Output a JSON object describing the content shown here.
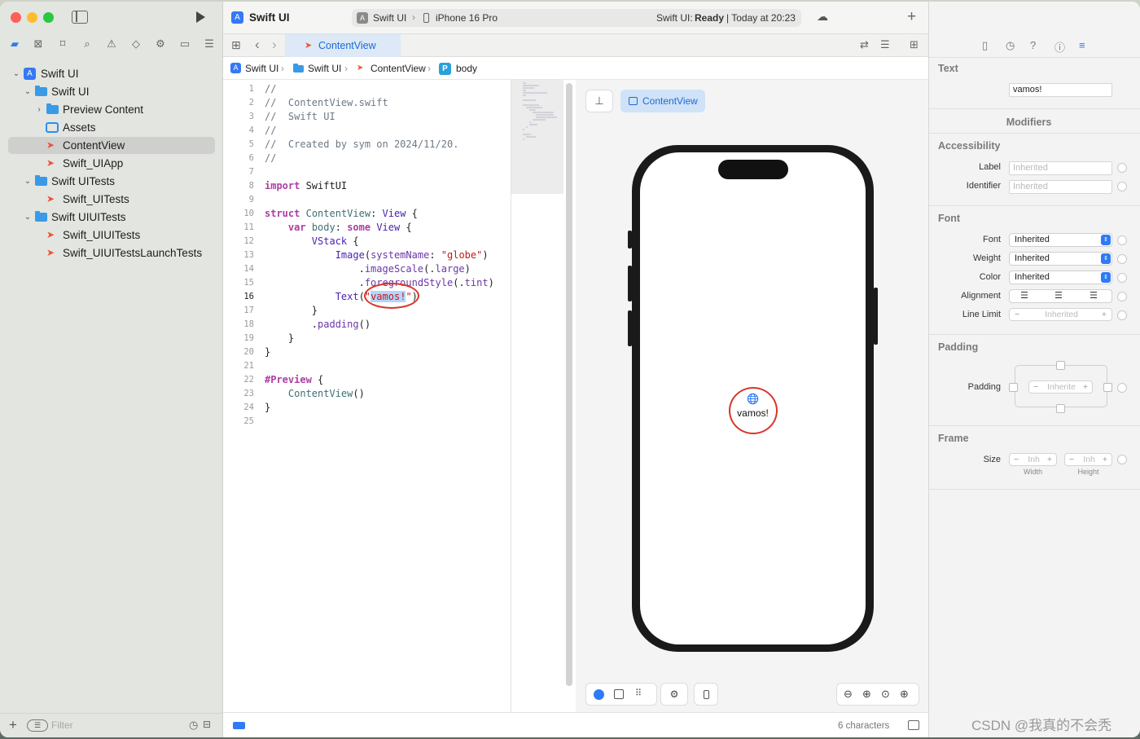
{
  "project": {
    "name": "Swift UI"
  },
  "toolbar": {
    "scheme_name": "Swift UI",
    "destination": "iPhone 16 Pro",
    "status_project": "Swift UI:",
    "status_state": "Ready",
    "status_time": "| Today at 20:23",
    "add_icon": "plus-icon",
    "run_icon": "play-icon"
  },
  "sidebar": {
    "tree": [
      {
        "label": "Swift UI"
      },
      {
        "label": "Swift UI"
      },
      {
        "label": "Preview Content"
      },
      {
        "label": "Assets"
      },
      {
        "label": "ContentView"
      },
      {
        "label": "Swift_UIApp"
      },
      {
        "label": "Swift UITests"
      },
      {
        "label": "Swift_UITests"
      },
      {
        "label": "Swift UIUITests"
      },
      {
        "label": "Swift_UIUITests"
      },
      {
        "label": "Swift_UIUITestsLaunchTests"
      }
    ],
    "filter_placeholder": "Filter"
  },
  "tabbar": {
    "active_tab": "ContentView"
  },
  "jumpbar": {
    "crumbs": [
      "Swift UI",
      "Swift UI",
      "ContentView",
      "body"
    ]
  },
  "editor": {
    "line_numbers": [
      "1",
      "2",
      "3",
      "4",
      "5",
      "6",
      "7",
      "8",
      "9",
      "10",
      "11",
      "12",
      "13",
      "14",
      "15",
      "16",
      "17",
      "18",
      "19",
      "20",
      "21",
      "22",
      "23",
      "24",
      "25"
    ],
    "current_line": "16"
  },
  "preview": {
    "pill_label": "ContentView",
    "text": "vamos!",
    "globe_icon": "globe-icon"
  },
  "statusbar": {
    "chars": "6 characters"
  },
  "inspector": {
    "text_section": "Text",
    "text_value": "vamos!",
    "modifiers": "Modifiers",
    "accessibility": "Accessibility",
    "label_label": "Label",
    "label_placeholder": "Inherited",
    "identifier_label": "Identifier",
    "identifier_placeholder": "Inherited",
    "font_section": "Font",
    "font_label": "Font",
    "font_value": "Inherited",
    "weight_label": "Weight",
    "weight_value": "Inherited",
    "color_label": "Color",
    "color_value": "Inherited",
    "alignment_label": "Alignment",
    "line_limit_label": "Line Limit",
    "line_limit_value": "Inherited",
    "padding_section": "Padding",
    "padding_label": "Padding",
    "padding_value": "Inherite",
    "frame_section": "Frame",
    "size_label": "Size",
    "width_value": "Inh",
    "height_value": "Inh",
    "width_caption": "Width",
    "height_caption": "Height"
  },
  "watermark": "CSDN @我真的不会秃"
}
